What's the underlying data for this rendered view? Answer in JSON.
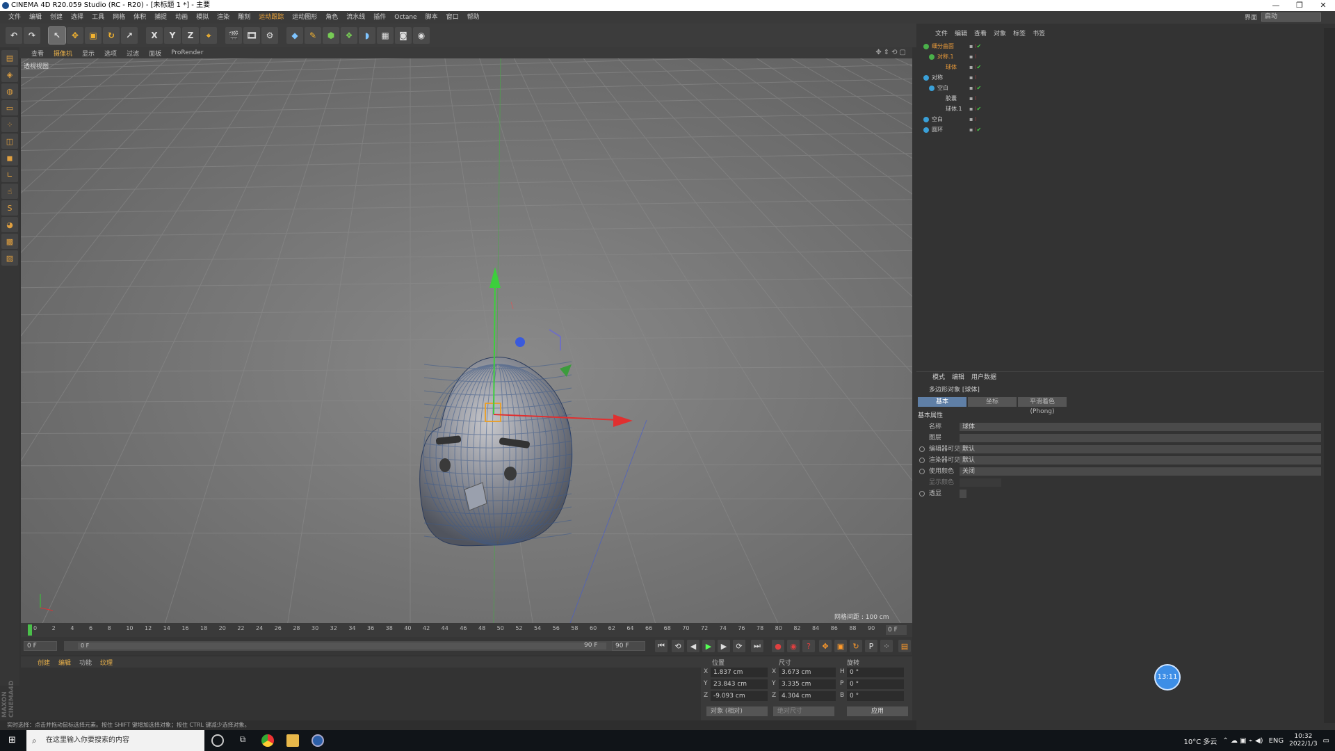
{
  "window": {
    "title": "CINEMA 4D R20.059 Studio (RC - R20) - [未标题 1 *] - 主要",
    "controls": [
      "—",
      "❐",
      "✕"
    ]
  },
  "menubar": {
    "items": [
      "文件",
      "编辑",
      "创建",
      "选择",
      "工具",
      "网格",
      "体积",
      "捕捉",
      "动画",
      "模拟",
      "渲染",
      "雕刻",
      "运动跟踪",
      "运动图形",
      "角色",
      "流水线",
      "插件",
      "Octane",
      "脚本",
      "窗口",
      "帮助"
    ],
    "layout_label": "界面",
    "layout_value": "启动"
  },
  "toolbar": {
    "undo": "↶",
    "move": "✥",
    "scale": "▣",
    "rotate": "↻",
    "x": "X",
    "y": "Y",
    "z": "Z"
  },
  "viewport": {
    "menu": [
      "查看",
      "摄像机",
      "显示",
      "选项",
      "过滤",
      "面板",
      "ProRender"
    ],
    "label": "透视视图",
    "grid_spacing": "网格间距 : 100 cm"
  },
  "timeline": {
    "ticks": [
      "0",
      "2",
      "4",
      "6",
      "8",
      "10",
      "12",
      "14",
      "16",
      "18",
      "20",
      "22",
      "24",
      "26",
      "28",
      "30",
      "32",
      "34",
      "36",
      "38",
      "40",
      "42",
      "44",
      "46",
      "48",
      "50",
      "52",
      "54",
      "56",
      "58",
      "60",
      "62",
      "64",
      "66",
      "68",
      "70",
      "72",
      "74",
      "76",
      "78",
      "80",
      "82",
      "84",
      "86",
      "88",
      "90"
    ],
    "end_frame": "0 F",
    "current": "0 F",
    "range_start": "0 F",
    "range_end": "90 F",
    "max": "90 F"
  },
  "material_menu": [
    "创建",
    "编辑",
    "功能",
    "纹理"
  ],
  "coords": {
    "headers": {
      "pos": "位置",
      "size": "尺寸",
      "rot": "旋转"
    },
    "rows": [
      {
        "axis": "X",
        "pos": "1.837 cm",
        "size_axis": "X",
        "size": "3.673 cm",
        "rot_axis": "H",
        "rot": "0 °"
      },
      {
        "axis": "Y",
        "pos": "23.843 cm",
        "size_axis": "Y",
        "size": "3.335 cm",
        "rot_axis": "P",
        "rot": "0 °"
      },
      {
        "axis": "Z",
        "pos": "-9.093 cm",
        "size_axis": "Z",
        "size": "4.304 cm",
        "rot_axis": "B",
        "rot": "0 °"
      }
    ],
    "mode": "对象 (相对)",
    "size_mode": "绝对尺寸",
    "apply": "应用"
  },
  "status_text": "实时选择：点击并拖动鼠标选择元素。按住 SHIFT 键增加选择对象；按住 CTRL 键减少选择对象。",
  "objects": {
    "menu": [
      "文件",
      "编辑",
      "查看",
      "对象",
      "标签",
      "书签"
    ],
    "rows": [
      {
        "name": "细分曲面",
        "indent": 10,
        "color": "#e89a3a"
      },
      {
        "name": "对称.1",
        "indent": 18,
        "color": "#e89a3a"
      },
      {
        "name": "球体",
        "indent": 30,
        "color": "#e89a3a"
      },
      {
        "name": "对称",
        "indent": 10,
        "color": "#cccccc"
      },
      {
        "name": "空白",
        "indent": 18,
        "color": "#cccccc"
      },
      {
        "name": "胶囊",
        "indent": 30,
        "color": "#cccccc"
      },
      {
        "name": "球体.1",
        "indent": 30,
        "color": "#cccccc"
      },
      {
        "name": "空白",
        "indent": 10,
        "color": "#cccccc"
      },
      {
        "name": "圆环",
        "indent": 10,
        "color": "#cccccc"
      }
    ]
  },
  "attributes": {
    "menu": [
      "模式",
      "编辑",
      "用户数据"
    ],
    "title": "多边形对象 [球体]",
    "tabs": [
      "基本",
      "坐标",
      "平滑着色(Phong)"
    ],
    "section": "基本属性",
    "fields": [
      {
        "label": "名称",
        "value": "球体"
      },
      {
        "label": "图层",
        "value": ""
      },
      {
        "label": "编辑器可见",
        "value": "默认"
      },
      {
        "label": "渲染器可见",
        "value": "默认"
      },
      {
        "label": "使用颜色",
        "value": "关闭"
      },
      {
        "label": "显示颜色",
        "value": ""
      },
      {
        "label": "透显",
        "value": ""
      }
    ]
  },
  "recording_badge": "13:11",
  "taskbar": {
    "search_placeholder": "在这里输入你要搜索的内容",
    "weather": "10°C 多云",
    "lang": "ENG",
    "time": "10:32",
    "date": "2022/1/3"
  }
}
